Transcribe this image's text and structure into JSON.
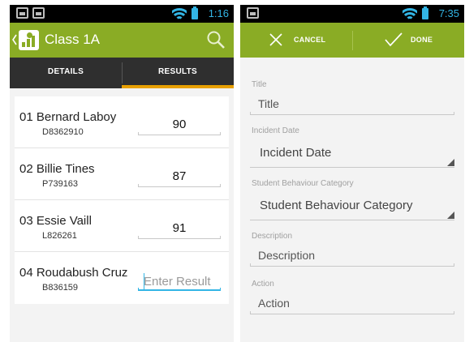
{
  "left": {
    "status": {
      "time": "1:16",
      "notif_icons": [
        "image-icon",
        "image-icon"
      ]
    },
    "actionbar": {
      "title": "Class 1A",
      "icons": [
        "back-caret-icon",
        "app-logo-icon",
        "search-icon"
      ]
    },
    "tabs": [
      {
        "label": "DETAILS",
        "active": false
      },
      {
        "label": "RESULTS",
        "active": true
      }
    ],
    "results": [
      {
        "name": "01 Bernard Laboy",
        "id": "D8362910",
        "score": "90",
        "placeholder": ""
      },
      {
        "name": "02 Billie Tines",
        "id": "P739163",
        "score": "87",
        "placeholder": ""
      },
      {
        "name": "03 Essie Vaill",
        "id": "L826261",
        "score": "91",
        "placeholder": ""
      },
      {
        "name": "04 Roudabush Cruz",
        "id": "B836159",
        "score": "",
        "placeholder": "Enter Result"
      }
    ]
  },
  "right": {
    "status": {
      "time": "7:35",
      "notif_icons": [
        "image-icon"
      ]
    },
    "actionbar": {
      "cancel_label": "CANCEL",
      "done_label": "DONE",
      "icons": [
        "close-icon",
        "check-icon"
      ]
    },
    "form": {
      "title": {
        "label": "Title",
        "hint": "Title"
      },
      "incident_date": {
        "label": "Incident Date",
        "hint": "Incident Date"
      },
      "category": {
        "label": "Student Behaviour Category",
        "hint": "Student Behaviour Category"
      },
      "description": {
        "label": "Description",
        "hint": "Description"
      },
      "action": {
        "label": "Action",
        "hint": "Action"
      }
    }
  },
  "colors": {
    "accent_green": "#8aac25",
    "holo_blue": "#33b5e5",
    "tab_indicator": "#e8a000",
    "tab_bg": "#2f2f2f"
  }
}
